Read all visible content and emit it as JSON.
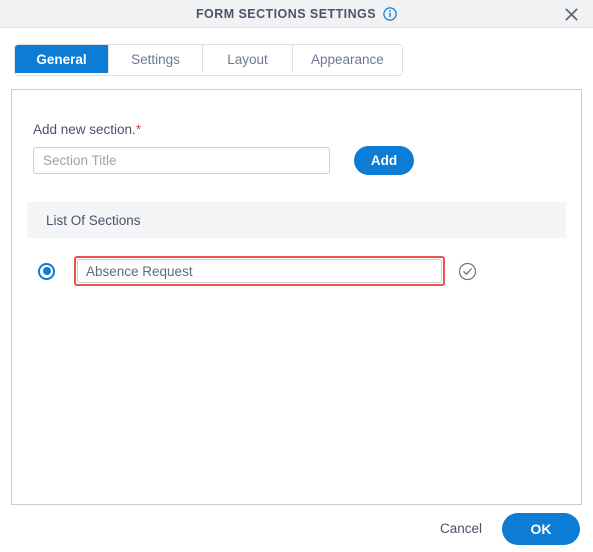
{
  "dialog": {
    "title": "FORM SECTIONS SETTINGS",
    "info_icon": "info-circle-icon",
    "close_icon": "close-icon"
  },
  "tabs": [
    {
      "label": "General",
      "active": true
    },
    {
      "label": "Settings",
      "active": false
    },
    {
      "label": "Layout",
      "active": false
    },
    {
      "label": "Appearance",
      "active": false
    }
  ],
  "general": {
    "add_label": "Add new section.",
    "required_marker": "*",
    "new_section_input": {
      "placeholder": "Section Title",
      "value": ""
    },
    "add_button_label": "Add",
    "list_header": "List Of Sections",
    "sections": [
      {
        "value": "Absence Request",
        "selected": true,
        "error": true,
        "confirm_icon": "check-circle-icon"
      }
    ]
  },
  "footer": {
    "cancel_label": "Cancel",
    "ok_label": "OK"
  },
  "colors": {
    "accent": "#0c7cd5",
    "error": "#e8534a",
    "titlebar_bg": "#f1f2f3",
    "list_header_bg": "#f4f5f6",
    "text": "#4a5568"
  }
}
